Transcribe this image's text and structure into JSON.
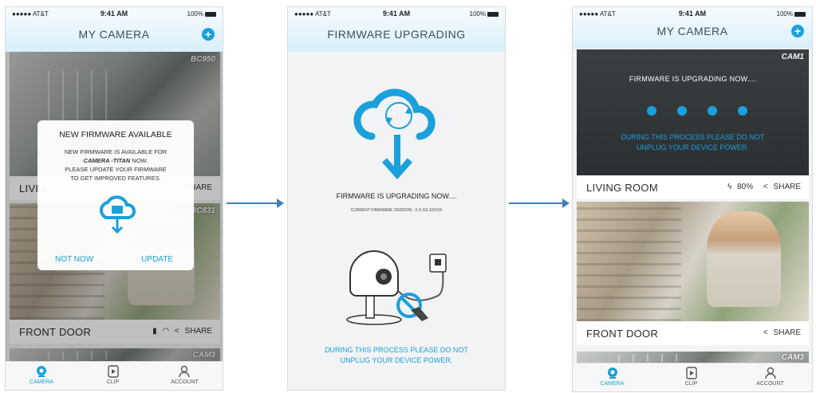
{
  "status": {
    "carrier": "●●●●● AT&T",
    "time": "9:41 AM",
    "battery": "100%"
  },
  "screen1": {
    "title": "MY CAMERA",
    "add_icon": "plus-circle-icon",
    "cards": [
      {
        "name": "LIVING ROOM",
        "name_visible": "LIVIN",
        "cam": "BC950",
        "share": "SHARE"
      },
      {
        "name": "FRONT DOOR",
        "cam": "BC831",
        "share": "SHARE"
      },
      {
        "cam": "CAM3"
      }
    ],
    "modal": {
      "title": "NEW FIRMWARE AVAILABLE",
      "line1": "NEW FIRMWARE IS AVAILABLE FOR",
      "device": "CAMERA -TITAN",
      "line2_suffix": " NOW.",
      "line3": "PLEASE UPDATE YOUR FIRMWARE",
      "line4": "TO GET IMPROVED FEATURES.",
      "not_now": "NOT NOW",
      "update": "UPDATE"
    },
    "tabs": [
      {
        "label": "CAMERA",
        "icon": "camera-icon"
      },
      {
        "label": "CLIP",
        "icon": "film-icon"
      },
      {
        "label": "ACCOUNT",
        "icon": "user-icon"
      }
    ]
  },
  "screen2": {
    "title": "FIRMWARE UPGRADING",
    "status": "FIRMWARE IS UPGRADING NOW....",
    "version": "CURRENT FIRMWARE VERSION : X.X.XX.XXXXX",
    "warning_line1": "DURING THIS PROCESS PLEASE DO NOT",
    "warning_line2": "UNPLUG YOUR DEVICE POWER."
  },
  "screen3": {
    "title": "MY CAMERA",
    "cards": [
      {
        "name": "LIVING ROOM",
        "cam": "CAM1",
        "battery": "80%",
        "share": "SHARE",
        "overlay_text": "FIRMWARE IS UPGRADING NOW....",
        "warning_line1": "DURING THIS PROCESS PLEASE DO NOT",
        "warning_line2": "UNPLUG YOUR DEVICE POWER."
      },
      {
        "name": "FRONT DOOR",
        "share": "SHARE"
      },
      {
        "cam": "CAM3"
      }
    ],
    "tabs": [
      {
        "label": "CAMERA"
      },
      {
        "label": "CLIP"
      },
      {
        "label": "ACCOUNT"
      }
    ]
  },
  "colors": {
    "accent": "#1aa0dc",
    "arrow": "#3f7fbf"
  }
}
